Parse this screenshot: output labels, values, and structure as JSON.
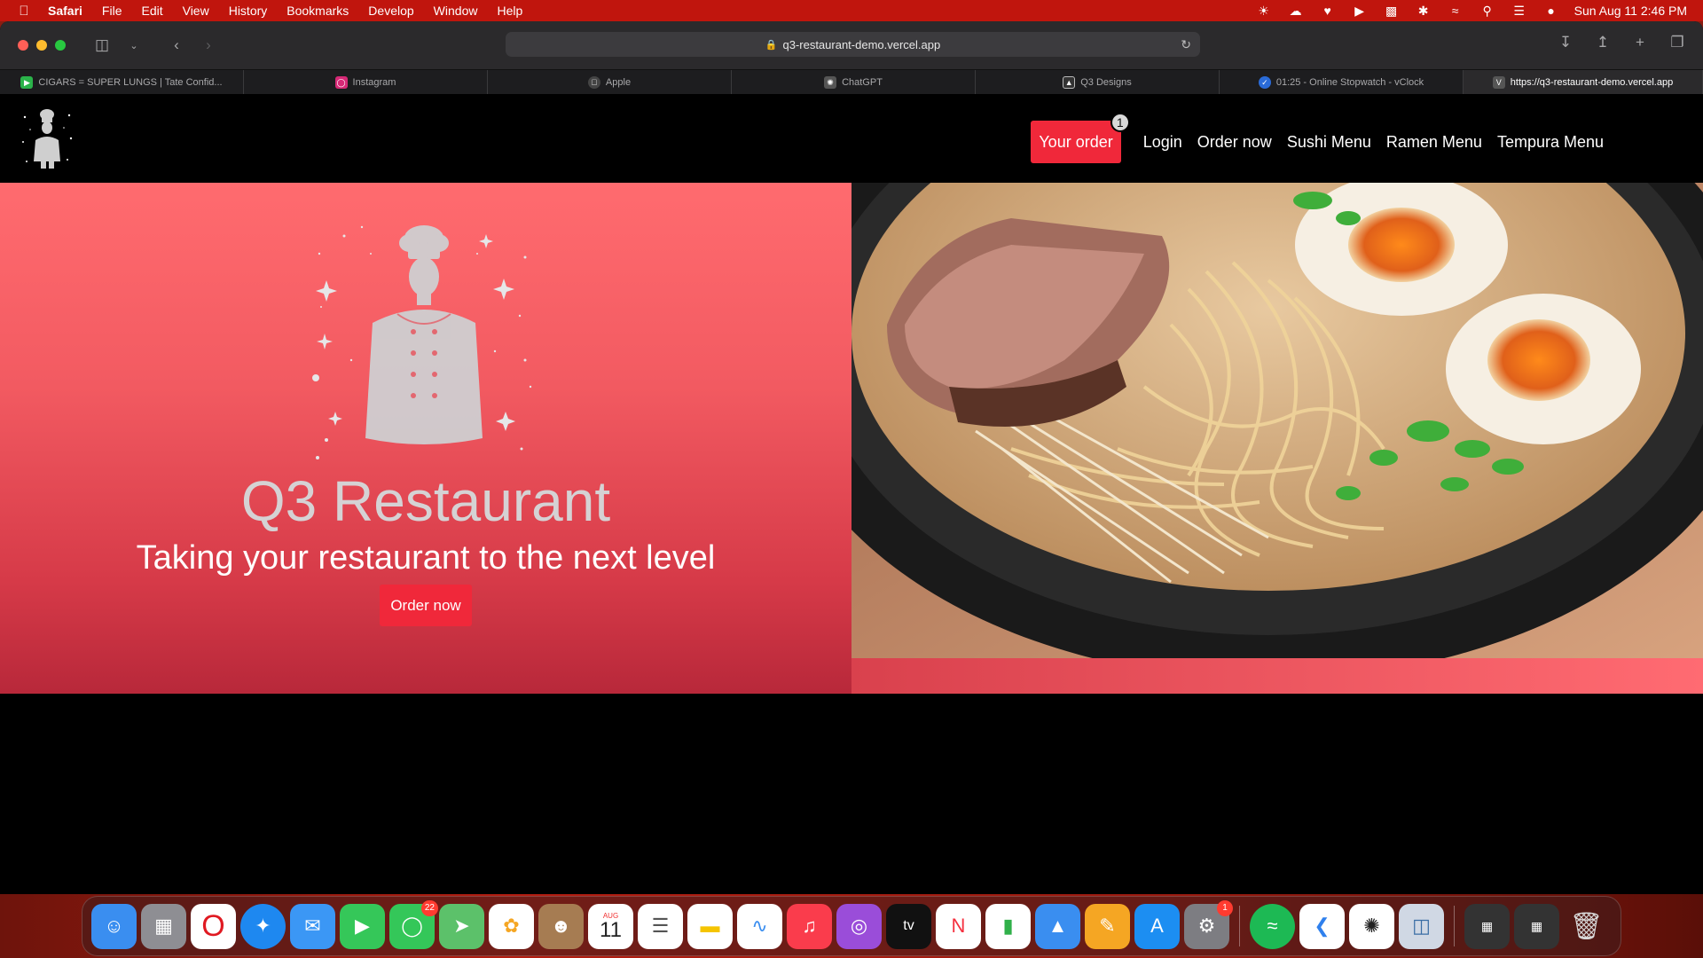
{
  "menubar": {
    "app": "Safari",
    "items": [
      "File",
      "Edit",
      "View",
      "History",
      "Bookmarks",
      "Develop",
      "Window",
      "Help"
    ],
    "clock": "Sun Aug 11  2:46 PM"
  },
  "browser": {
    "address": "q3-restaurant-demo.vercel.app",
    "tabs": [
      {
        "label": "CIGARS = SUPER LUNGS | Tate Confid...",
        "favicon_color": "#2bb34a"
      },
      {
        "label": "Instagram",
        "favicon_color": "#d62976"
      },
      {
        "label": "Apple",
        "favicon_color": "#444444"
      },
      {
        "label": "ChatGPT",
        "favicon_color": "#555555"
      },
      {
        "label": "Q3 Designs",
        "favicon_color": "#333333"
      },
      {
        "label": "01:25 - Online Stopwatch - vClock",
        "favicon_color": "#2a6bd8"
      },
      {
        "label": "https://q3-restaurant-demo.vercel.app",
        "favicon_color": "#555555"
      }
    ]
  },
  "site": {
    "nav": {
      "order_button": "Your order",
      "order_count": "1",
      "links": [
        "Login",
        "Order now",
        "Sushi Menu",
        "Ramen Menu",
        "Tempura Menu"
      ]
    },
    "hero": {
      "title": "Q3 Restaurant",
      "subtitle": "Taking your restaurant to the next level",
      "cta": "Order now"
    }
  },
  "dock": {
    "messages_badge": "22",
    "calendar_month": "AUG",
    "calendar_day": "11",
    "settings_badge": "1"
  },
  "colors": {
    "accent": "#f0283a",
    "menubar": "#c0150d"
  }
}
